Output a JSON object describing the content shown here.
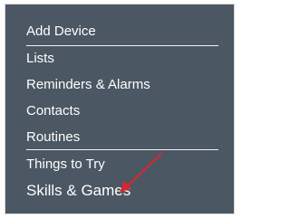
{
  "menu": {
    "items": [
      {
        "label": "Add Device"
      },
      {
        "label": "Lists"
      },
      {
        "label": "Reminders & Alarms"
      },
      {
        "label": "Contacts"
      },
      {
        "label": "Routines"
      },
      {
        "label": "Things to Try"
      },
      {
        "label": "Skills & Games"
      }
    ]
  },
  "annotation": {
    "arrow_color": "#e0242b",
    "icon": "arrow-icon"
  },
  "colors": {
    "menu_background": "#4b5763",
    "text": "#ffffff"
  }
}
